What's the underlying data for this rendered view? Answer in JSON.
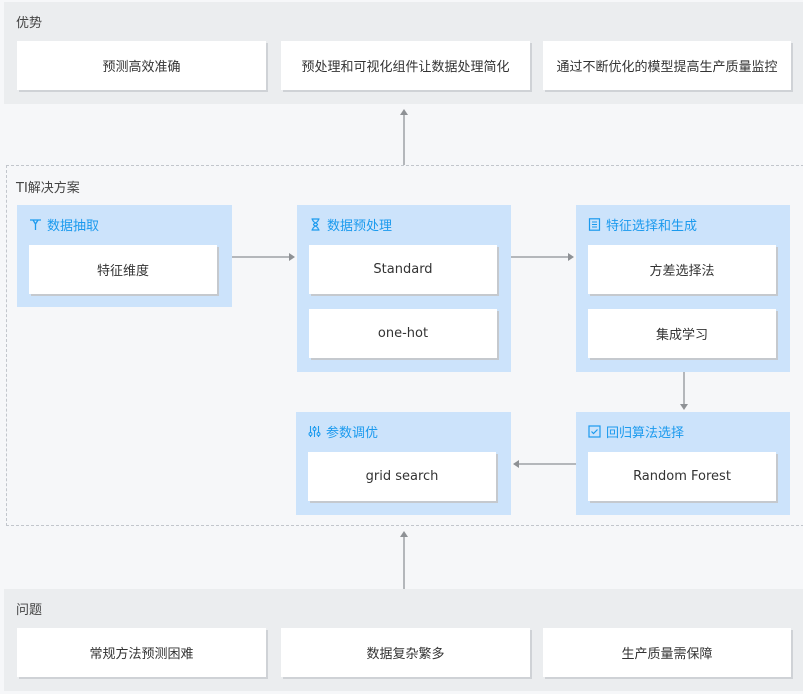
{
  "advantages": {
    "title": "优势",
    "items": [
      "预测高效准确",
      "预处理和可视化组件让数据处理简化",
      "通过不断优化的模型提高生产质量监控"
    ]
  },
  "solution": {
    "title": "TI解决方案",
    "steps": [
      {
        "title": "数据抽取",
        "icon": "filter-icon",
        "items": [
          "特征维度"
        ]
      },
      {
        "title": "数据预处理",
        "icon": "hourglass-icon",
        "items": [
          "Standard",
          "one-hot"
        ]
      },
      {
        "title": "特征选择和生成",
        "icon": "list-icon",
        "items": [
          "方差选择法",
          "集成学习"
        ]
      },
      {
        "title": "参数调优",
        "icon": "sliders-icon",
        "items": [
          "grid search"
        ]
      },
      {
        "title": "回归算法选择",
        "icon": "checkbox-icon",
        "items": [
          "Random Forest"
        ]
      }
    ]
  },
  "problems": {
    "title": "问题",
    "items": [
      "常规方法预测困难",
      "数据复杂繁多",
      "生产质量需保障"
    ]
  },
  "colors": {
    "accent": "#1b9aee",
    "step_bg": "#cce3fb",
    "band_bg": "#ebedef",
    "arrow": "#b4b7bb"
  }
}
